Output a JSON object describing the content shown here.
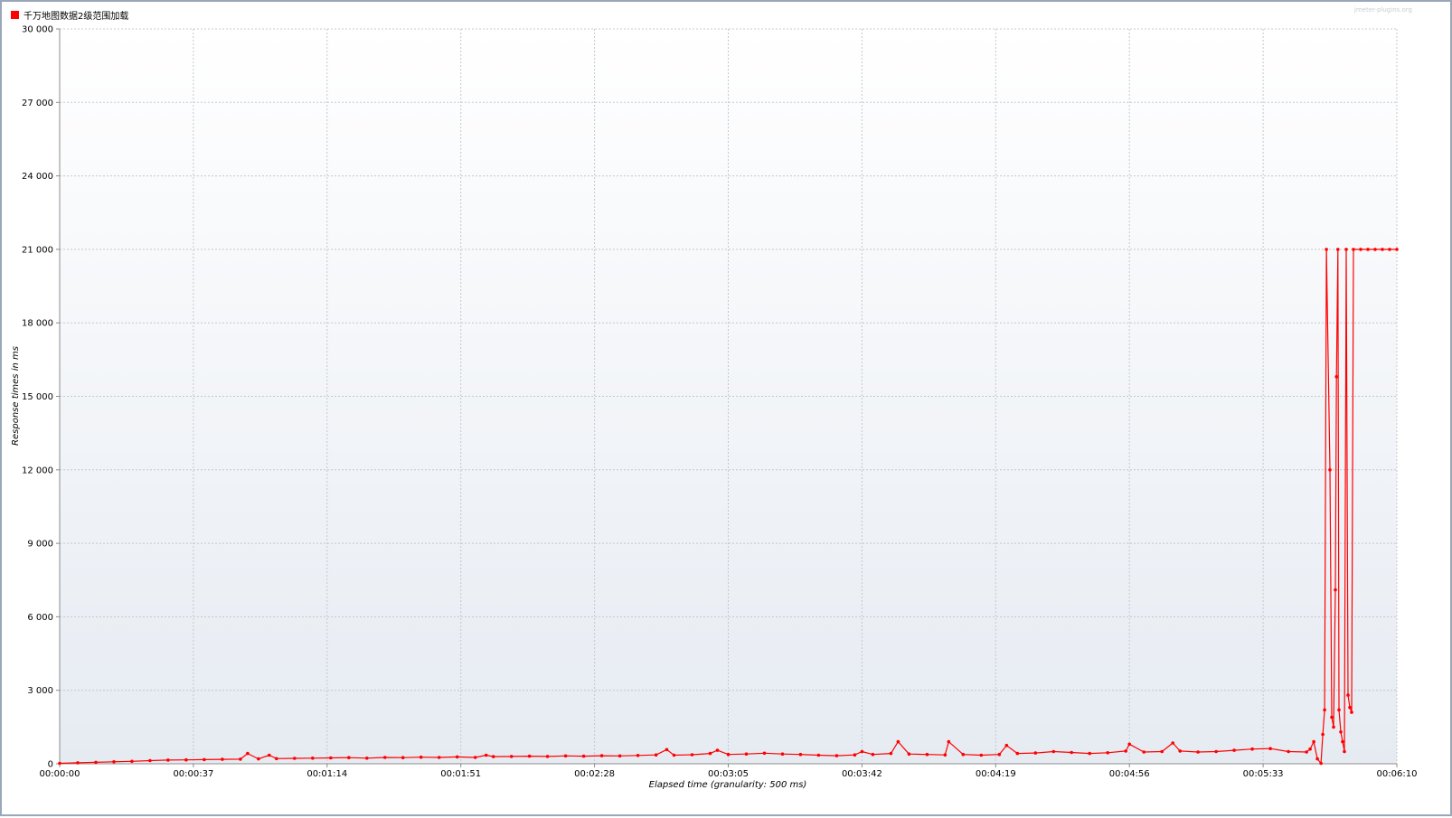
{
  "chart_data": {
    "type": "line",
    "watermark": "jmeter-plugins.org",
    "xlabel": "Elapsed time (granularity: 500 ms)",
    "ylabel": "Response times in ms",
    "ylim": [
      0,
      30000
    ],
    "y_ticks": [
      "0",
      "3 000",
      "6 000",
      "9 000",
      "12 000",
      "15 000",
      "18 000",
      "21 000",
      "24 000",
      "27 000",
      "30 000"
    ],
    "y_tick_values": [
      0,
      3000,
      6000,
      9000,
      12000,
      15000,
      18000,
      21000,
      24000,
      27000,
      30000
    ],
    "xlim": [
      0,
      370
    ],
    "x_ticks": [
      "00:00:00",
      "00:00:37",
      "00:01:14",
      "00:01:51",
      "00:02:28",
      "00:03:05",
      "00:03:42",
      "00:04:19",
      "00:04:56",
      "00:05:33",
      "00:06:10"
    ],
    "x_tick_values": [
      0,
      37,
      74,
      111,
      148,
      185,
      222,
      259,
      296,
      333,
      370
    ],
    "grid": true,
    "legend_position": "top-left",
    "series": [
      {
        "name": "千万地图数据2级范围加载",
        "color": "#ff0000",
        "points": [
          [
            0,
            20
          ],
          [
            5,
            40
          ],
          [
            10,
            60
          ],
          [
            15,
            80
          ],
          [
            20,
            100
          ],
          [
            25,
            130
          ],
          [
            30,
            150
          ],
          [
            35,
            160
          ],
          [
            40,
            170
          ],
          [
            45,
            180
          ],
          [
            50,
            190
          ],
          [
            52,
            420
          ],
          [
            55,
            200
          ],
          [
            58,
            350
          ],
          [
            60,
            210
          ],
          [
            65,
            220
          ],
          [
            70,
            230
          ],
          [
            75,
            240
          ],
          [
            80,
            250
          ],
          [
            85,
            230
          ],
          [
            90,
            260
          ],
          [
            95,
            250
          ],
          [
            100,
            270
          ],
          [
            105,
            260
          ],
          [
            110,
            280
          ],
          [
            115,
            260
          ],
          [
            118,
            350
          ],
          [
            120,
            290
          ],
          [
            125,
            300
          ],
          [
            130,
            310
          ],
          [
            135,
            300
          ],
          [
            140,
            320
          ],
          [
            145,
            310
          ],
          [
            150,
            330
          ],
          [
            155,
            320
          ],
          [
            160,
            340
          ],
          [
            165,
            360
          ],
          [
            168,
            580
          ],
          [
            170,
            350
          ],
          [
            175,
            370
          ],
          [
            180,
            420
          ],
          [
            182,
            550
          ],
          [
            185,
            380
          ],
          [
            190,
            400
          ],
          [
            195,
            430
          ],
          [
            200,
            400
          ],
          [
            205,
            380
          ],
          [
            210,
            350
          ],
          [
            215,
            330
          ],
          [
            220,
            360
          ],
          [
            222,
            500
          ],
          [
            225,
            380
          ],
          [
            230,
            420
          ],
          [
            232,
            900
          ],
          [
            235,
            400
          ],
          [
            240,
            380
          ],
          [
            245,
            360
          ],
          [
            246,
            900
          ],
          [
            250,
            380
          ],
          [
            255,
            350
          ],
          [
            260,
            380
          ],
          [
            262,
            750
          ],
          [
            265,
            420
          ],
          [
            270,
            440
          ],
          [
            275,
            500
          ],
          [
            280,
            460
          ],
          [
            285,
            420
          ],
          [
            290,
            450
          ],
          [
            295,
            520
          ],
          [
            296,
            800
          ],
          [
            300,
            480
          ],
          [
            305,
            500
          ],
          [
            308,
            850
          ],
          [
            310,
            520
          ],
          [
            315,
            480
          ],
          [
            320,
            500
          ],
          [
            325,
            550
          ],
          [
            330,
            600
          ],
          [
            335,
            620
          ],
          [
            340,
            500
          ],
          [
            345,
            480
          ],
          [
            346,
            600
          ],
          [
            347,
            900
          ],
          [
            348,
            200
          ],
          [
            349,
            20
          ],
          [
            349.5,
            1200
          ],
          [
            350,
            2200
          ],
          [
            350.5,
            21000
          ],
          [
            351.5,
            12000
          ],
          [
            352,
            1900
          ],
          [
            352.5,
            1500
          ],
          [
            353,
            7100
          ],
          [
            353.3,
            15800
          ],
          [
            353.7,
            21000
          ],
          [
            354,
            2200
          ],
          [
            354.5,
            1300
          ],
          [
            355,
            900
          ],
          [
            355.5,
            500
          ],
          [
            356,
            21000
          ],
          [
            356.5,
            2800
          ],
          [
            357,
            2300
          ],
          [
            357.5,
            2100
          ],
          [
            358,
            21000
          ],
          [
            360,
            21000
          ],
          [
            362,
            21000
          ],
          [
            364,
            21000
          ],
          [
            366,
            21000
          ],
          [
            368,
            21000
          ],
          [
            370,
            21000
          ]
        ]
      }
    ]
  }
}
